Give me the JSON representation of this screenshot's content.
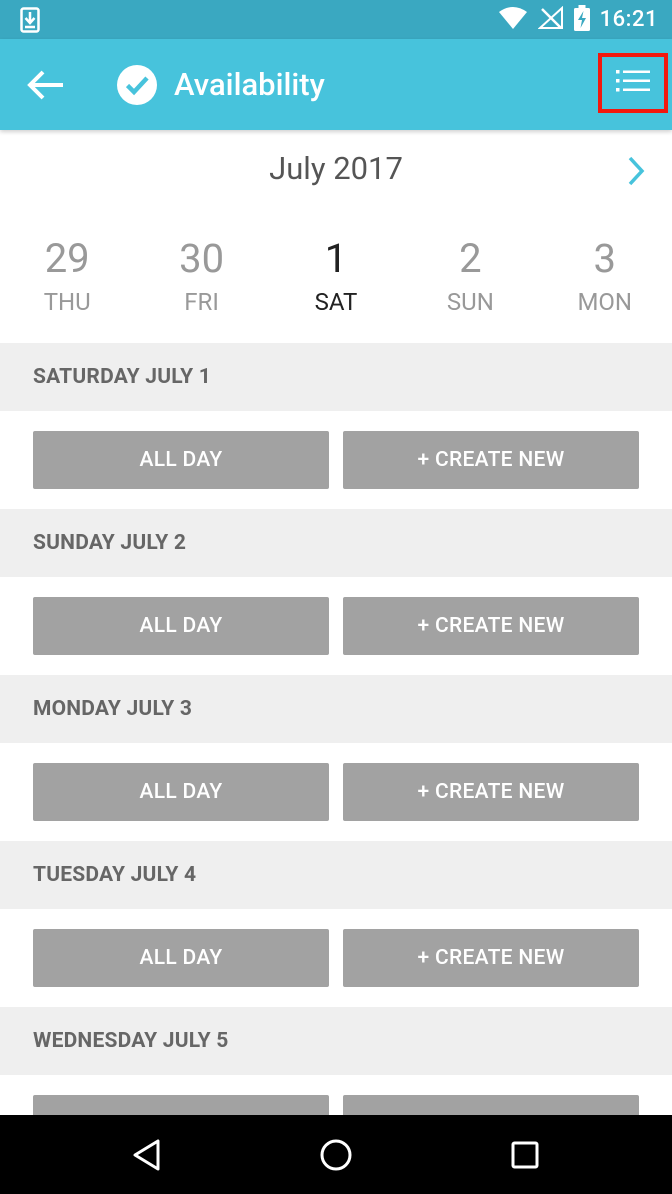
{
  "status_bar": {
    "time": "16:21"
  },
  "app_bar": {
    "title": "Availability",
    "back_icon": "arrow-left-icon",
    "title_icon": "check-circle-icon",
    "menu_icon": "list-icon"
  },
  "calendar": {
    "month_label": "July 2017",
    "next_icon": "chevron-right-icon",
    "days": [
      {
        "num": "29",
        "dow": "THU",
        "selected": false
      },
      {
        "num": "30",
        "dow": "FRI",
        "selected": false
      },
      {
        "num": "1",
        "dow": "SAT",
        "selected": true
      },
      {
        "num": "2",
        "dow": "SUN",
        "selected": false
      },
      {
        "num": "3",
        "dow": "MON",
        "selected": false
      }
    ]
  },
  "schedule": [
    {
      "header": "SATURDAY JULY 1",
      "all_day": "ALL DAY",
      "create_new": "+ CREATE NEW"
    },
    {
      "header": "SUNDAY JULY 2",
      "all_day": "ALL DAY",
      "create_new": "+ CREATE NEW"
    },
    {
      "header": "MONDAY JULY 3",
      "all_day": "ALL DAY",
      "create_new": "+ CREATE NEW"
    },
    {
      "header": "TUESDAY JULY 4",
      "all_day": "ALL DAY",
      "create_new": "+ CREATE NEW"
    },
    {
      "header": "WEDNESDAY JULY 5",
      "all_day": "",
      "create_new": ""
    }
  ],
  "colors": {
    "status_bar": "#3aa8c1",
    "app_bar": "#47c3dc",
    "highlight": "#f2180e",
    "button": "#a2a2a2",
    "section_bg": "#efefef"
  }
}
